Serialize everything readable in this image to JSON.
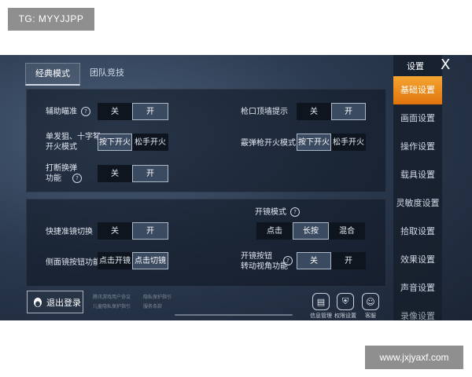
{
  "watermark": "TG: MYYJJPP",
  "site_watermark": "www.jxjyaxf.com",
  "tabs": [
    "经典模式",
    "团队竞技"
  ],
  "panel1": {
    "assist_aim": {
      "label": "辅助瞄准",
      "options": [
        "关",
        "开"
      ],
      "selected": "开"
    },
    "muzzle_hint": {
      "label": "枪口顶墙提示",
      "options": [
        "关",
        "开"
      ],
      "selected": "开"
    },
    "single_fire": {
      "label_line1": "单发狙、十字弩",
      "label_line2": "开火模式",
      "options": [
        "按下开火",
        "松手开火"
      ],
      "selected": "按下开火"
    },
    "shotgun_fire": {
      "label": "霰弹枪开火模式",
      "options": [
        "按下开火",
        "松手开火"
      ],
      "selected": "按下开火"
    },
    "interrupt_reload": {
      "label_line1": "打断换弹",
      "label_line2": "功能",
      "options": [
        "关",
        "开"
      ],
      "selected": "开"
    }
  },
  "panel2": {
    "scope_mode": {
      "label": "开镜模式",
      "options": [
        "点击",
        "长按",
        "混合"
      ],
      "selected": "长按"
    },
    "quick_scope": {
      "label": "快捷准镜切换",
      "options": [
        "关",
        "开"
      ],
      "selected": "开"
    },
    "side_scope": {
      "label": "侧面镜按钮功能",
      "options": [
        "点击开镜",
        "点击切镜"
      ],
      "selected": "点击切镜"
    },
    "scope_rotate": {
      "label_line1": "开镜按钮",
      "label_line2": "转动视角功能",
      "options": [
        "关",
        "开"
      ],
      "selected": "关"
    }
  },
  "footer": {
    "logout": "退出登录",
    "links_col1": [
      "腾讯游戏用户协议",
      "儿童隐私保护指引"
    ],
    "links_col2": [
      "隐私保护指引",
      "服务条款"
    ],
    "icons": [
      {
        "name": "info",
        "label": "信息管理"
      },
      {
        "name": "permission",
        "label": "权限设置"
      },
      {
        "name": "service",
        "label": "客服"
      }
    ]
  },
  "sidebar": {
    "title": "设置",
    "close": "X",
    "items": [
      "基础设置",
      "画面设置",
      "操作设置",
      "载具设置",
      "灵敏度设置",
      "拾取设置",
      "效果设置",
      "声音设置",
      "录像设置"
    ],
    "active": "基础设置"
  },
  "colors": {
    "accent": "#f08a1c",
    "selected_option": "#3a4a60"
  }
}
